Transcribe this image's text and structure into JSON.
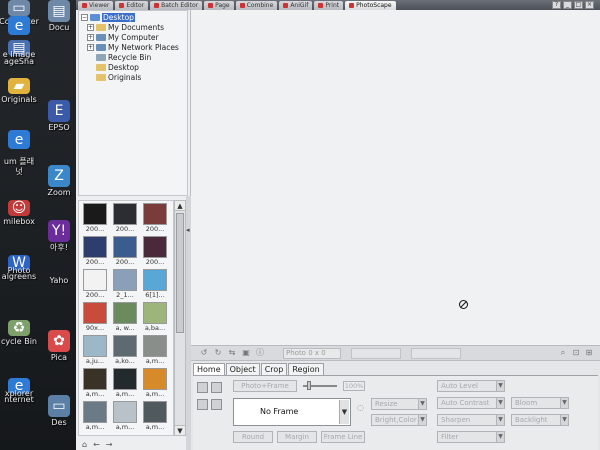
{
  "desktop": {
    "col1": [
      {
        "label": "Computer",
        "icon": "computer-icon",
        "color": "#6e88a8"
      },
      {
        "label": "",
        "icon": "internet-explorer-icon",
        "color": "#2e7bd6"
      },
      {
        "label": "ageSha",
        "icon": "pagesha-icon",
        "color": "#4a6fb0"
      },
      {
        "label": "e Image",
        "icon": "",
        "color": ""
      },
      {
        "label": "Originals",
        "icon": "folder-icon",
        "color": "#e2b33c"
      },
      {
        "label": "",
        "icon": "internet-explorer-icon",
        "color": "#2e7bd6"
      },
      {
        "label": "um 플래",
        "icon": "",
        "color": ""
      },
      {
        "label": "넛",
        "icon": "",
        "color": ""
      },
      {
        "label": "milebox",
        "icon": "smilebox-icon",
        "color": "#c23b3b"
      },
      {
        "label": "algreens",
        "icon": "walgreens-icon",
        "color": "#2c63c4"
      },
      {
        "label": "Photo",
        "icon": "",
        "color": ""
      },
      {
        "label": "cycle Bin",
        "icon": "recycle-bin-icon",
        "color": "#7ea06b"
      },
      {
        "label": "nternet",
        "icon": "internet-explorer-icon",
        "color": "#2e7bd6"
      },
      {
        "label": "xplorer",
        "icon": "",
        "color": ""
      }
    ],
    "col2": [
      {
        "label": "Docu",
        "icon": "docu-icon",
        "color": "#6e88a8"
      },
      {
        "label": "EPSO",
        "icon": "epson-icon",
        "color": "#3b5aa8"
      },
      {
        "label": "Zoom",
        "icon": "zoom-icon",
        "color": "#3a88c9"
      },
      {
        "label": "아후!",
        "icon": "yahoo-icon",
        "color": "#6a2d9a"
      },
      {
        "label": "Yaho",
        "icon": "",
        "color": ""
      },
      {
        "label": "Pica",
        "icon": "picasa-icon",
        "color": "#d94a4a"
      },
      {
        "label": "Des",
        "icon": "desktop-icon",
        "color": "#5c7fa6"
      }
    ]
  },
  "app": {
    "tabs": [
      {
        "label": "Viewer"
      },
      {
        "label": "Editor"
      },
      {
        "label": "Batch Editor"
      },
      {
        "label": "Page"
      },
      {
        "label": "Combine"
      },
      {
        "label": "AniGif"
      },
      {
        "label": "Print"
      },
      {
        "label": "PhotoScape"
      }
    ],
    "active_tab": 7
  },
  "folder_tree": {
    "items": [
      {
        "label": "Desktop",
        "toggle": "⊟",
        "color": "#5b8fd6",
        "selected": true
      },
      {
        "label": "My Documents",
        "toggle": "⊞",
        "color": "#e3c26a",
        "selected": false
      },
      {
        "label": "My Computer",
        "toggle": "⊞",
        "color": "#6b8fb8",
        "selected": false
      },
      {
        "label": "My Network Places",
        "toggle": "⊞",
        "color": "#6b8fb8",
        "selected": false
      },
      {
        "label": "Recycle Bin",
        "toggle": "",
        "color": "#8fa6b8",
        "selected": false
      },
      {
        "label": "Desktop",
        "toggle": "",
        "color": "#e3c26a",
        "selected": false
      },
      {
        "label": "Originals",
        "toggle": "",
        "color": "#e3c26a",
        "selected": false
      }
    ]
  },
  "thumbnails": [
    {
      "label": "200...",
      "color": "#1a1a1a"
    },
    {
      "label": "200...",
      "color": "#2b2d33"
    },
    {
      "label": "200...",
      "color": "#7a3b3b"
    },
    {
      "label": "200...",
      "color": "#2c3d6e"
    },
    {
      "label": "200...",
      "color": "#3b5c8e"
    },
    {
      "label": "200...",
      "color": "#4a2a3a"
    },
    {
      "label": "200...",
      "color": "#f2f2f2"
    },
    {
      "label": "2_1...",
      "color": "#8a9fb8"
    },
    {
      "label": "6[1]...",
      "color": "#59a7d6"
    },
    {
      "label": "90x...",
      "color": "#c94b3b"
    },
    {
      "label": "a, w...",
      "color": "#6b8a5e"
    },
    {
      "label": "a,ba...",
      "color": "#9bb57a"
    },
    {
      "label": "a,ju...",
      "color": "#9cb8c8"
    },
    {
      "label": "a,ko...",
      "color": "#5e6a72"
    },
    {
      "label": "a,m...",
      "color": "#8a8e8a"
    },
    {
      "label": "a,m...",
      "color": "#3a3226"
    },
    {
      "label": "a,m...",
      "color": "#222a2e"
    },
    {
      "label": "a,m...",
      "color": "#d68a2a"
    },
    {
      "label": "a,m...",
      "color": "#6a7a86"
    },
    {
      "label": "a,m...",
      "color": "#b8c2c8"
    },
    {
      "label": "a,m...",
      "color": "#505a5e"
    }
  ],
  "bottom_nav": {
    "prev": "←",
    "next": "→",
    "home": "⌂"
  },
  "edit_toolbar": {
    "photo_count": "Photo 0 x 0"
  },
  "edit_panel": {
    "tabs": [
      {
        "label": "Home"
      },
      {
        "label": "Object"
      },
      {
        "label": "Crop"
      },
      {
        "label": "Region"
      }
    ],
    "active_tab": 0,
    "photo_frame_label": "Photo+Frame",
    "frame_value": "No Frame",
    "slider_value": "100%",
    "buttons": {
      "round": "Round",
      "margin": "Margin",
      "frame_line": "Frame Line",
      "resize": "Resize",
      "bright_color": "Bright,Color",
      "auto_level": "Auto Level",
      "auto_contrast": "Auto Contrast",
      "sharpen": "Sharpen",
      "filter": "Filter",
      "bloom": "Bloom",
      "backlight": "Backlight"
    }
  }
}
